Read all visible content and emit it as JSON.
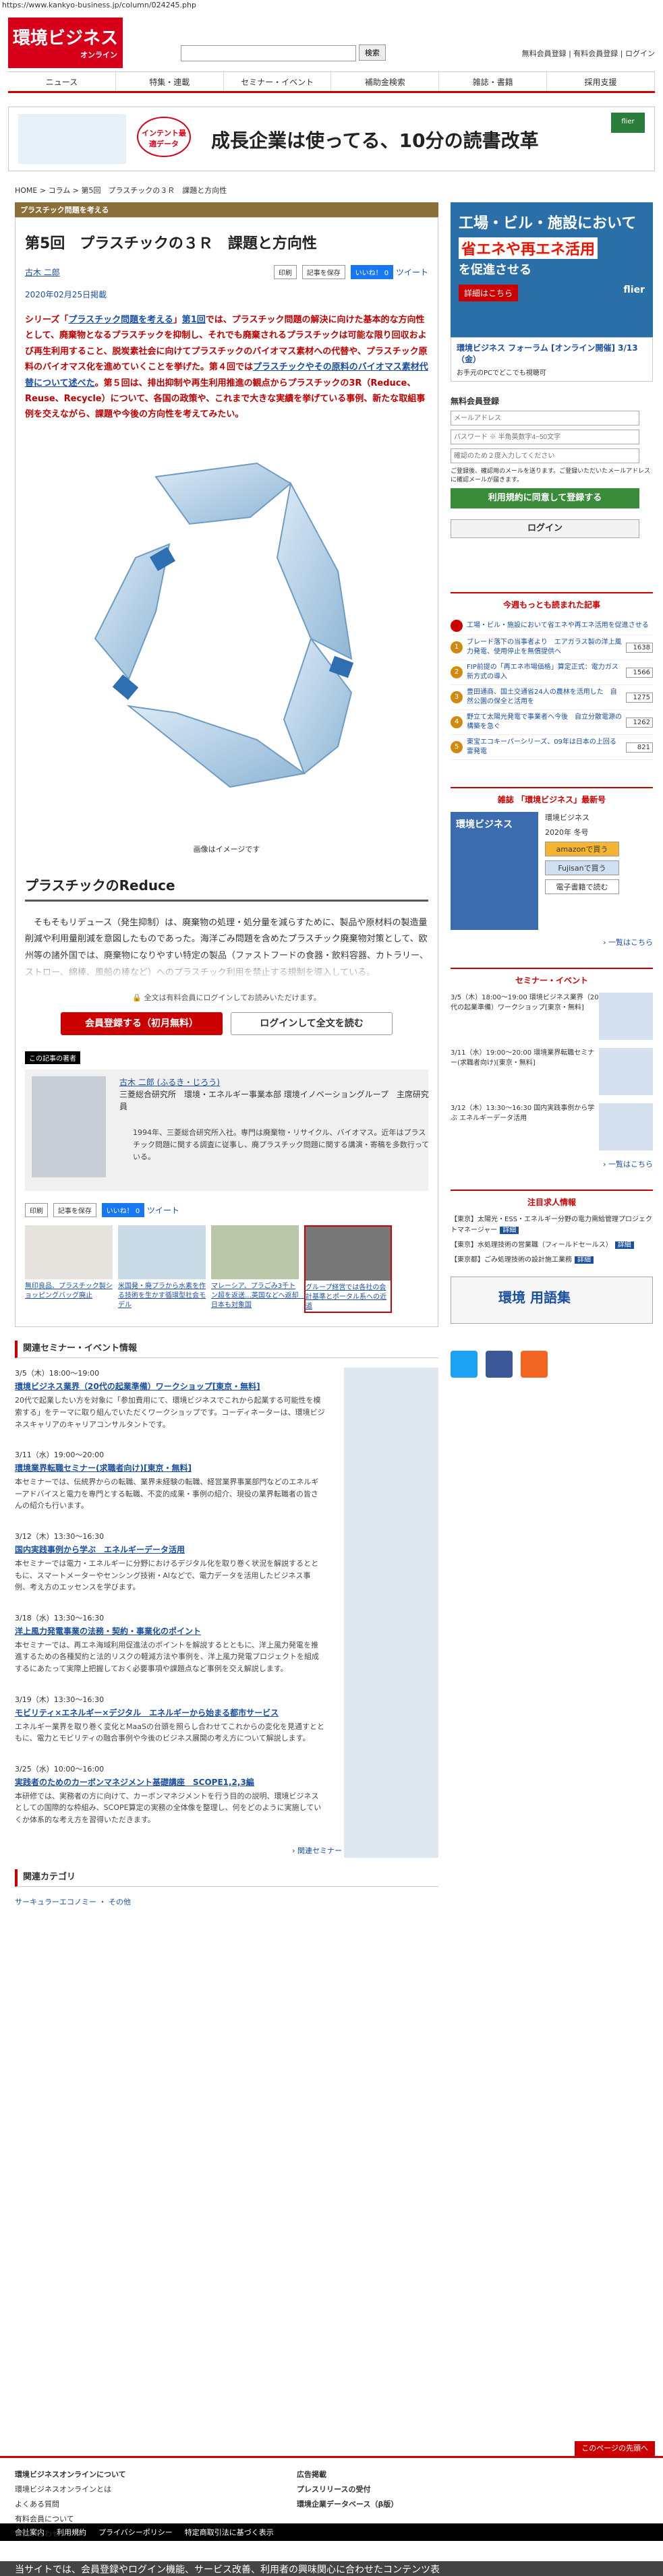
{
  "url": "https://www.kankyo-business.jp/column/024245.php",
  "header": {
    "logo_main": "環境ビジネス",
    "logo_sub": "オンライン",
    "search_button": "検索",
    "links": "無料会員登録 | 有料会員登録 | ログイン"
  },
  "nav": [
    "ニュース",
    "特集・連載",
    "セミナー・イベント",
    "補助金検索",
    "雑誌・書籍",
    "採用支援"
  ],
  "banner": {
    "badge": "インテント最適データ",
    "text": "成長企業は使ってる、10分の読書改革",
    "brand": "flier"
  },
  "breadcrumb": "HOME > コラム > 第5回　プラスチックの３Ｒ　課題と方向性",
  "category": "プラスチック問題を考える",
  "article": {
    "title": "第5回　プラスチックの３Ｒ　課題と方向性",
    "author": "古木 二郎",
    "btn_print": "印刷",
    "btn_save": "記事を保存",
    "btn_like": "いいね！ 0",
    "btn_tweet": "ツイート",
    "date": "2020年02月25日掲載",
    "lead_1": "シリーズ「",
    "lead_link_1": "プラスチック問題を考える",
    "lead_2": "」",
    "lead_link_2": "第1回",
    "lead_3": "では、プラスチック問題の解決に向けた基本的な方向性として、廃棄物となるプラスチックを抑制し、それでも廃棄されるプラスチックは可能な限り回収および再生利用すること、脱炭素社会に向けてプラスチックのバイオマス素材への代替や、プラスチック原料のバイオマス化を進めていくことを挙げた。第４回では",
    "lead_link_3": "プラスチックやその原料のバイオマス素材代替について述べた",
    "lead_4": "。第５回は、排出抑制や再生利用推進の観点からプラスチックの3R（Reduce、Reuse、Recycle）について、各国の政策や、これまで大きな実績を挙げている事例、新たな取組事例を交えながら、課題や今後の方向性を考えてみたい。",
    "caption": "画像はイメージです",
    "h2": "プラスチックのReduce",
    "body": "そもそもリデュース（発生抑制）は、廃棄物の処理・処分量を減らすために、製品や原材料の製造量削減や利用量削減を意図したものであった。海洋ごみ問題を含めたプラスチック廃棄物対策として、欧州等の諸外国では、廃棄物になりやすい特定の製品（ファストフードの食器・飲料容器、カトラリー、ストロー、綿棒、風船の棒など）へのプラスチック利用を禁止する規制を導入している。",
    "lock_note": "全文は有料会員にログインしてお読みいただけます。",
    "register_button": "会員登録する（初月無料）",
    "login_button": "ログインして全文を読む"
  },
  "writer": {
    "heading": "この記事の著者",
    "name": "古木 二郎 (ふるき・じろう)",
    "title": "三菱総合研究所　環境・エネルギー事業本部 環境イノベーショングループ　主席研究員",
    "desc": "1994年、三菱総合研究所入社。専門は廃棄物・リサイクル、バイオマス。近年はプラスチック問題に関する調査に従事し、廃プラスチック問題に関する講演・寄稿を多数行っている。"
  },
  "share": {
    "print": "印刷",
    "save": "記事を保存",
    "like": "いいね！ 0",
    "tweet": "ツイート"
  },
  "related": [
    {
      "title": "無印良品、プラスチック製ショッピングバッグ廃止"
    },
    {
      "title": "米国発・廃プラから水素を作る技術を生かす循環型社会モデル"
    },
    {
      "title": "マレーシア、プラごみ3千トン超を返送…英国などへ返却　日本も対象国"
    },
    {
      "title": "グループ経営では各社の会計基準とポータル系への近道"
    }
  ],
  "seminars": {
    "heading": "関連セミナー・イベント情報",
    "items": [
      {
        "date": "3/5（木）18:00～19:00",
        "title": "環境ビジネス業界（20代の起業準備）ワークショップ[東京・無料]",
        "desc": "20代で起業したい方を対象に「参加費用にて、環境ビジネスでこれから起業する可能性を模索する」をテーマに取り組んでいただくワークショップです。コーディネーターは、環境ビジネスキャリアのキャリアコンサルタントです。"
      },
      {
        "date": "3/11（水）19:00～20:00",
        "title": "環境業界転職セミナー(求職者向け)[東京・無料]",
        "desc": "本セミナーでは、伝統界からの転職、業界未経験の転職、経営業界事業部門などのエネルギーアドバイスと電力を専門とする転職、不変的成果・事例の紹介、現役の業界転職者の皆さんの紹介も行います。"
      },
      {
        "date": "3/12（木）13:30～16:30",
        "title": "国内実践事例から学ぶ　エネルギーデータ活用",
        "desc": "本セミナーでは電力・エネルギーに分野におけるデジタル化を取り巻く状況を解説するとともに、スマートメーターやセンシング技術・AIなどで、電力データを活用したビジネス事例、考え方のエッセンスを学びます。"
      },
      {
        "date": "3/18（水）13:30～16:30",
        "title": "洋上風力発電事業の法務・契約・事業化のポイント",
        "desc": "本セミナーでは、再エネ海域利用促進法のポイントを解説するとともに、洋上風力発電を推進するための各種契約と法的リスクの軽減方法や事例を、洋上風力発電プロジェクトを組成するにあたって実際上把握しておく必要事項や課題点など事例を交え解説します。"
      },
      {
        "date": "3/19（木）13:30～16:30",
        "title": "モビリティ×エネルギー×デジタル　エネルギーから始まる都市サービス",
        "desc": "エネルギー業界を取り巻く変化とMaaSの台頭を照らし合わせてこれからの変化を見通すとともに、電力とモビリティの融合事例や今後のビジネス展開の考え方について解説します。"
      },
      {
        "date": "3/25（水）10:00～16:00",
        "title": "実践者のためのカーボンマネジメント基礎講座　SCOPE1,2,3編",
        "desc": "本研修では、実務者の方に向けて、カーボンマネジメントを行う目的の説明、環境ビジネスとしての国際的な枠組み、SCOPE算定の実務の全体像を整理し、何をどのように実施していくか体系的な考え方を習得いただきます。"
      }
    ],
    "more": "関連セミナー・イベント情報をさらに見る"
  },
  "categories": {
    "heading": "関連カテゴリ",
    "items": "サーキュラーエコノミー ・ その他"
  },
  "sidebar": {
    "ad": {
      "l1": "工場・ビル・施設において",
      "l2": "省エネや再エネ活用",
      "l3": "を促進させる",
      "cta": "詳細はこちら",
      "brand": "flier"
    },
    "ad_link": "環境ビジネス フォーラム [オンライン開催] 3/13（金）",
    "ad_sub": "お手元のPCでどこでも視聴可",
    "login": {
      "title": "無料会員登録",
      "email_ph": "メールアドレス",
      "pass_ph": "パスワード ※ 半角英数字4~50文字",
      "confirm_ph": "確認のため２度入力してください",
      "note": "ご登録後、確認用のメールを送ります。ご登録いただいたメールアドレスに確認メールが届きます。",
      "register": "利用規約に同意して登録する",
      "login": "ログイン"
    },
    "ranking": {
      "title": "今週もっとも読まれた記事",
      "items": [
        {
          "n": "",
          "text": "工場・ビル・施設において省エネや再エネ活用を促進させる",
          "count": ""
        },
        {
          "n": "1",
          "text": "ブレード落下の当事者より　エアガラス製の洋上風力発電、使用停止を無償提供へ",
          "count": "1638"
        },
        {
          "n": "2",
          "text": "FIP前提の「再エネ市場価格」算定正式：電力ガス新方式の導入",
          "count": "1566"
        },
        {
          "n": "3",
          "text": "豊田通商、国土交通省24人の農林を活用した　自然公園の保全と活用を",
          "count": "1275"
        },
        {
          "n": "4",
          "text": "野立て太陽光発電で事業者へ今後　自立分散電源の構築を急ぐ",
          "count": "1262"
        },
        {
          "n": "5",
          "text": "東宝エコキーパーシリーズ、09年は日本の上回る雷発電",
          "count": "821"
        }
      ]
    },
    "magazine": {
      "title": "雑誌 「環境ビジネス」最新号",
      "cover": "環境ビジネス",
      "issue": "環境ビジネス",
      "date": "2020年 冬号",
      "amazon": "amazonで買う",
      "fujisan": "Fujisanで買う",
      "ebook": "電子書籍で読む",
      "more": "一覧はこちら"
    },
    "events": {
      "title": "セミナー・イベント",
      "items": [
        {
          "text": "3/5（木）18:00～19:00 環境ビジネス業界（20代の起業準備）ワークショップ[東京・無料]"
        },
        {
          "text": "3/11（水）19:00～20:00 環境業界転職セミナー(求職者向け)[東京・無料]"
        },
        {
          "text": "3/12（木）13:30～16:30 国内実践事例から学ぶ エネルギーデータ活用"
        }
      ],
      "more": "一覧はこちら"
    },
    "jobs": {
      "title": "注目求人情報",
      "items": [
        {
          "text": "【東京】太陽光・ESS・エネルギー分野の電力需給管理プロジェクトマネージャー",
          "tag": "詳細"
        },
        {
          "text": "【東京】水処理技術の営業職（フィールドセールス）",
          "tag": "詳細"
        },
        {
          "text": "【東京都】ごみ処理技術の設計施工業務",
          "tag": "詳細"
        }
      ]
    },
    "dict": "環境 用語集"
  },
  "footer": {
    "top_btn": "このページの先頭へ",
    "col1": [
      "環境ビジネスオンラインについて",
      "環境ビジネスオンラインとは",
      "よくある質問",
      "有料会員について",
      "お問い合わせ"
    ],
    "col2": [
      "広告掲載",
      "プレスリリースの受付",
      "環境企業データベース（β版）"
    ],
    "bottom": [
      "会社案内",
      "利用規約",
      "プライバシーポリシー",
      "特定商取引法に基づく表示"
    ],
    "cookie": "当サイトでは、会員登録やログイン機能、サービス改善、利用者の興味関心に合わせたコンテンツ表"
  }
}
